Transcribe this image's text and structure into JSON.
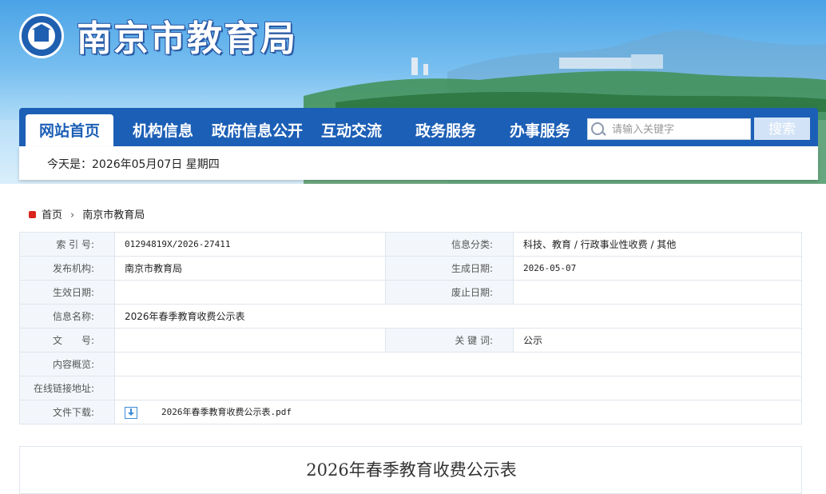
{
  "header": {
    "site_title": "南京市教育局"
  },
  "nav": {
    "items": [
      {
        "label": "网站首页"
      },
      {
        "label": "机构信息"
      },
      {
        "label": "政府信息公开"
      },
      {
        "label": "互动交流"
      },
      {
        "label": "政务服务"
      },
      {
        "label": "办事服务"
      }
    ],
    "active_index": 0
  },
  "search": {
    "placeholder": "请输入关键字",
    "button_label": "搜索"
  },
  "date_bar": {
    "text": "今天是：2026年05月07日 星期四"
  },
  "breadcrumb": {
    "home": "首页",
    "current": "南京市教育局"
  },
  "info": {
    "index_no_label": "索 引 号:",
    "index_no": "01294819X/2026-27411",
    "category_label": "信息分类:",
    "category": "科技、教育 / 行政事业性收费 / 其他",
    "publisher_label": "发布机构:",
    "publisher": "南京市教育局",
    "created_label": "生成日期:",
    "created": "2026-05-07",
    "effective_label": "生效日期:",
    "effective": "",
    "expired_label": "废止日期:",
    "expired": "",
    "name_label": "信息名称:",
    "name": "2026年春季教育收费公示表",
    "doc_no_label": "文　　号:",
    "doc_no": "",
    "keywords_label": "关 键 词:",
    "keywords": "公示",
    "summary_label": "内容概览:",
    "summary": "",
    "link_label": "在线链接地址:",
    "link": "",
    "download_label": "文件下载:",
    "download_file": "2026年春季教育收费公示表.pdf"
  },
  "document": {
    "title": "2026年春季教育收费公示表"
  },
  "colors": {
    "nav_blue": "#1c5fb6",
    "label_bg": "#f3f7fb",
    "breadcrumb_icon": "#d9251c"
  }
}
